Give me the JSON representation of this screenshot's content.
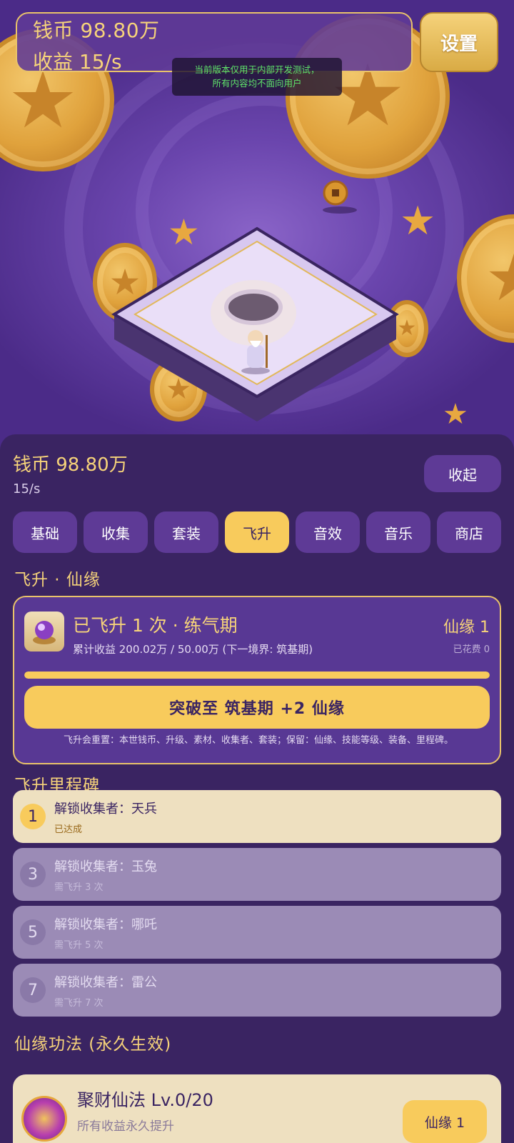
{
  "hud": {
    "coins": "钱币 98.80万",
    "income": "收益 15/s",
    "settings_label": "设置",
    "dev_notice_line1": "当前版本仅用于内部开发测试，",
    "dev_notice_line2": "所有内容均不面向用户"
  },
  "panel": {
    "coins": "钱币 98.80万",
    "rate": "15/s",
    "collapse_label": "收起",
    "tabs": [
      {
        "label": "基础",
        "active": false
      },
      {
        "label": "收集",
        "active": false
      },
      {
        "label": "套装",
        "active": false
      },
      {
        "label": "飞升",
        "active": true
      },
      {
        "label": "音效",
        "active": false
      },
      {
        "label": "音乐",
        "active": false
      },
      {
        "label": "商店",
        "active": false
      }
    ],
    "section_title": "飞升 · 仙缘",
    "ascend": {
      "title": "已飞升 1 次 · 练气期",
      "subtitle": "累计收益 200.02万 / 50.00万 (下一境界: 筑基期)",
      "xianyuan": "仙缘 1",
      "spent": "已花费 0",
      "progress": 1.0,
      "button": "突破至 筑基期 +2 仙缘",
      "note": "飞升会重置：本世钱币、升级、素材、收集者、套装；保留：仙缘、技能等级、装备、里程碑。"
    },
    "milestones_title": "飞升里程碑",
    "milestones": [
      {
        "num": "1",
        "title": "解锁收集者：天兵",
        "status": "已达成",
        "done": true
      },
      {
        "num": "3",
        "title": "解锁收集者：玉兔",
        "status": "需飞升 3 次",
        "done": false
      },
      {
        "num": "5",
        "title": "解锁收集者：哪吒",
        "status": "需飞升 5 次",
        "done": false
      },
      {
        "num": "7",
        "title": "解锁收集者：雷公",
        "status": "需飞升 7 次",
        "done": false
      }
    ],
    "skills_title": "仙缘功法 (永久生效)",
    "skill": {
      "name": "聚财仙法  Lv.0/20",
      "desc": "所有收益永久提升",
      "button": "仙缘 1"
    }
  },
  "colors": {
    "panel_bg": "#3a2462",
    "accent_gold": "#f8cb5c",
    "button_purple": "#5e3a96",
    "text_gold": "#f6d37a"
  }
}
